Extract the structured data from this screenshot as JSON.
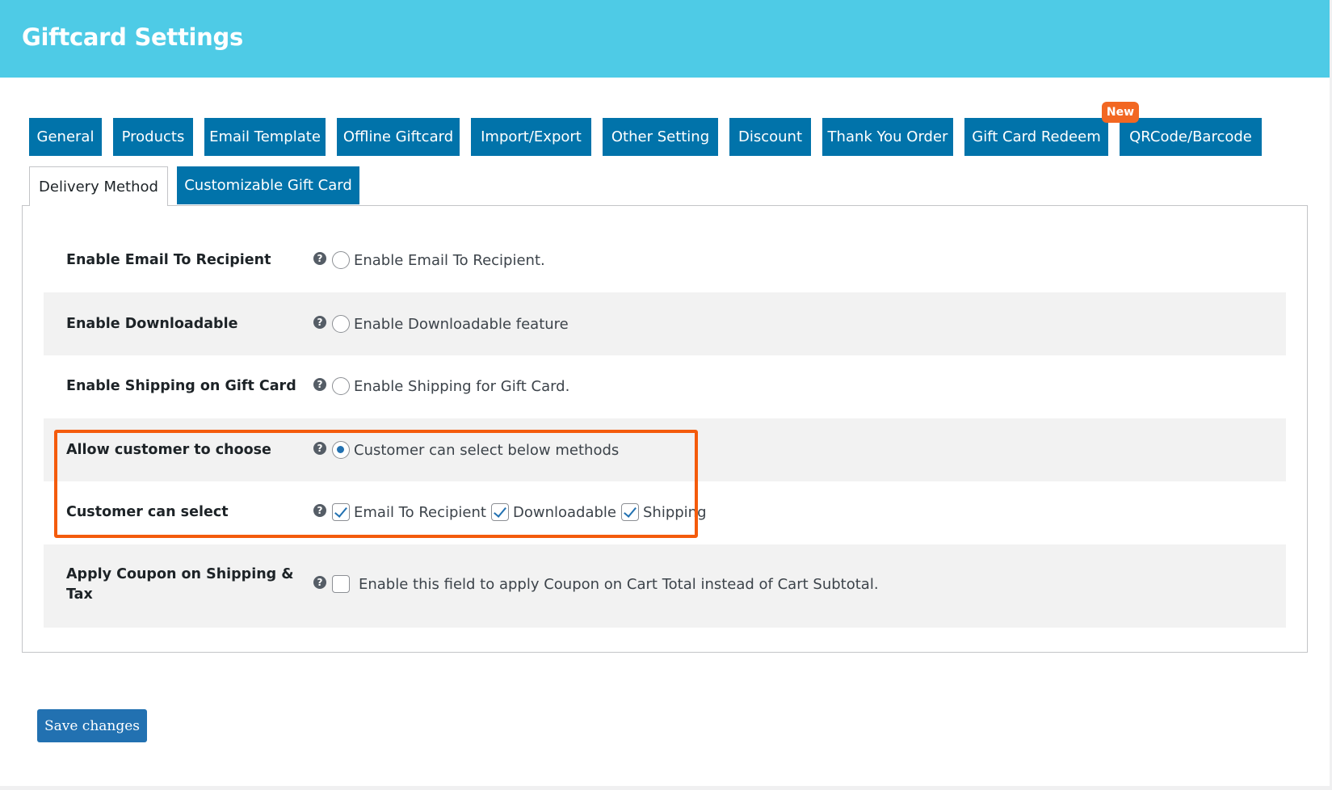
{
  "header": {
    "title": "Giftcard Settings"
  },
  "tabs": {
    "row1": [
      {
        "label": "General"
      },
      {
        "label": "Products"
      },
      {
        "label": "Email Template"
      },
      {
        "label": "Offline Giftcard"
      },
      {
        "label": "Import/Export"
      },
      {
        "label": "Other Setting"
      },
      {
        "label": "Discount"
      },
      {
        "label": "Thank You Order"
      },
      {
        "label": "Gift Card Redeem",
        "badge": "New"
      },
      {
        "label": "QRCode/Barcode"
      }
    ],
    "row2": [
      {
        "label": "Delivery Method",
        "active": true
      },
      {
        "label": "Customizable Gift Card",
        "active": false
      }
    ]
  },
  "settings": [
    {
      "label": "Enable Email To Recipient",
      "control": "radio",
      "checked": false,
      "option": "Enable Email To Recipient."
    },
    {
      "label": "Enable Downloadable",
      "control": "radio",
      "checked": false,
      "option": "Enable Downloadable feature"
    },
    {
      "label": "Enable Shipping on Gift Card",
      "control": "radio",
      "checked": false,
      "option": "Enable Shipping for Gift Card."
    },
    {
      "label": "Allow customer to choose",
      "control": "radio",
      "checked": true,
      "option": "Customer can select below methods"
    },
    {
      "label": "Customer can select",
      "control": "checkbox-group",
      "options": [
        {
          "label": "Email To Recipient",
          "checked": true
        },
        {
          "label": "Downloadable",
          "checked": true
        },
        {
          "label": "Shipping",
          "checked": true
        }
      ]
    },
    {
      "label_line1": "Apply Coupon on Shipping &",
      "label_line2": "Tax",
      "control": "checkbox",
      "checked": false,
      "option": "Enable this field to apply Coupon on Cart Total instead of Cart Subtotal."
    }
  ],
  "help_icon_glyph": "?",
  "save_button": {
    "label": "Save changes"
  },
  "colors": {
    "header_bg": "#4ecbe6",
    "tab_bg": "#0173aa",
    "badge_bg": "#f26722",
    "highlight_border": "#f45b0c",
    "button_bg": "#2271b1"
  }
}
